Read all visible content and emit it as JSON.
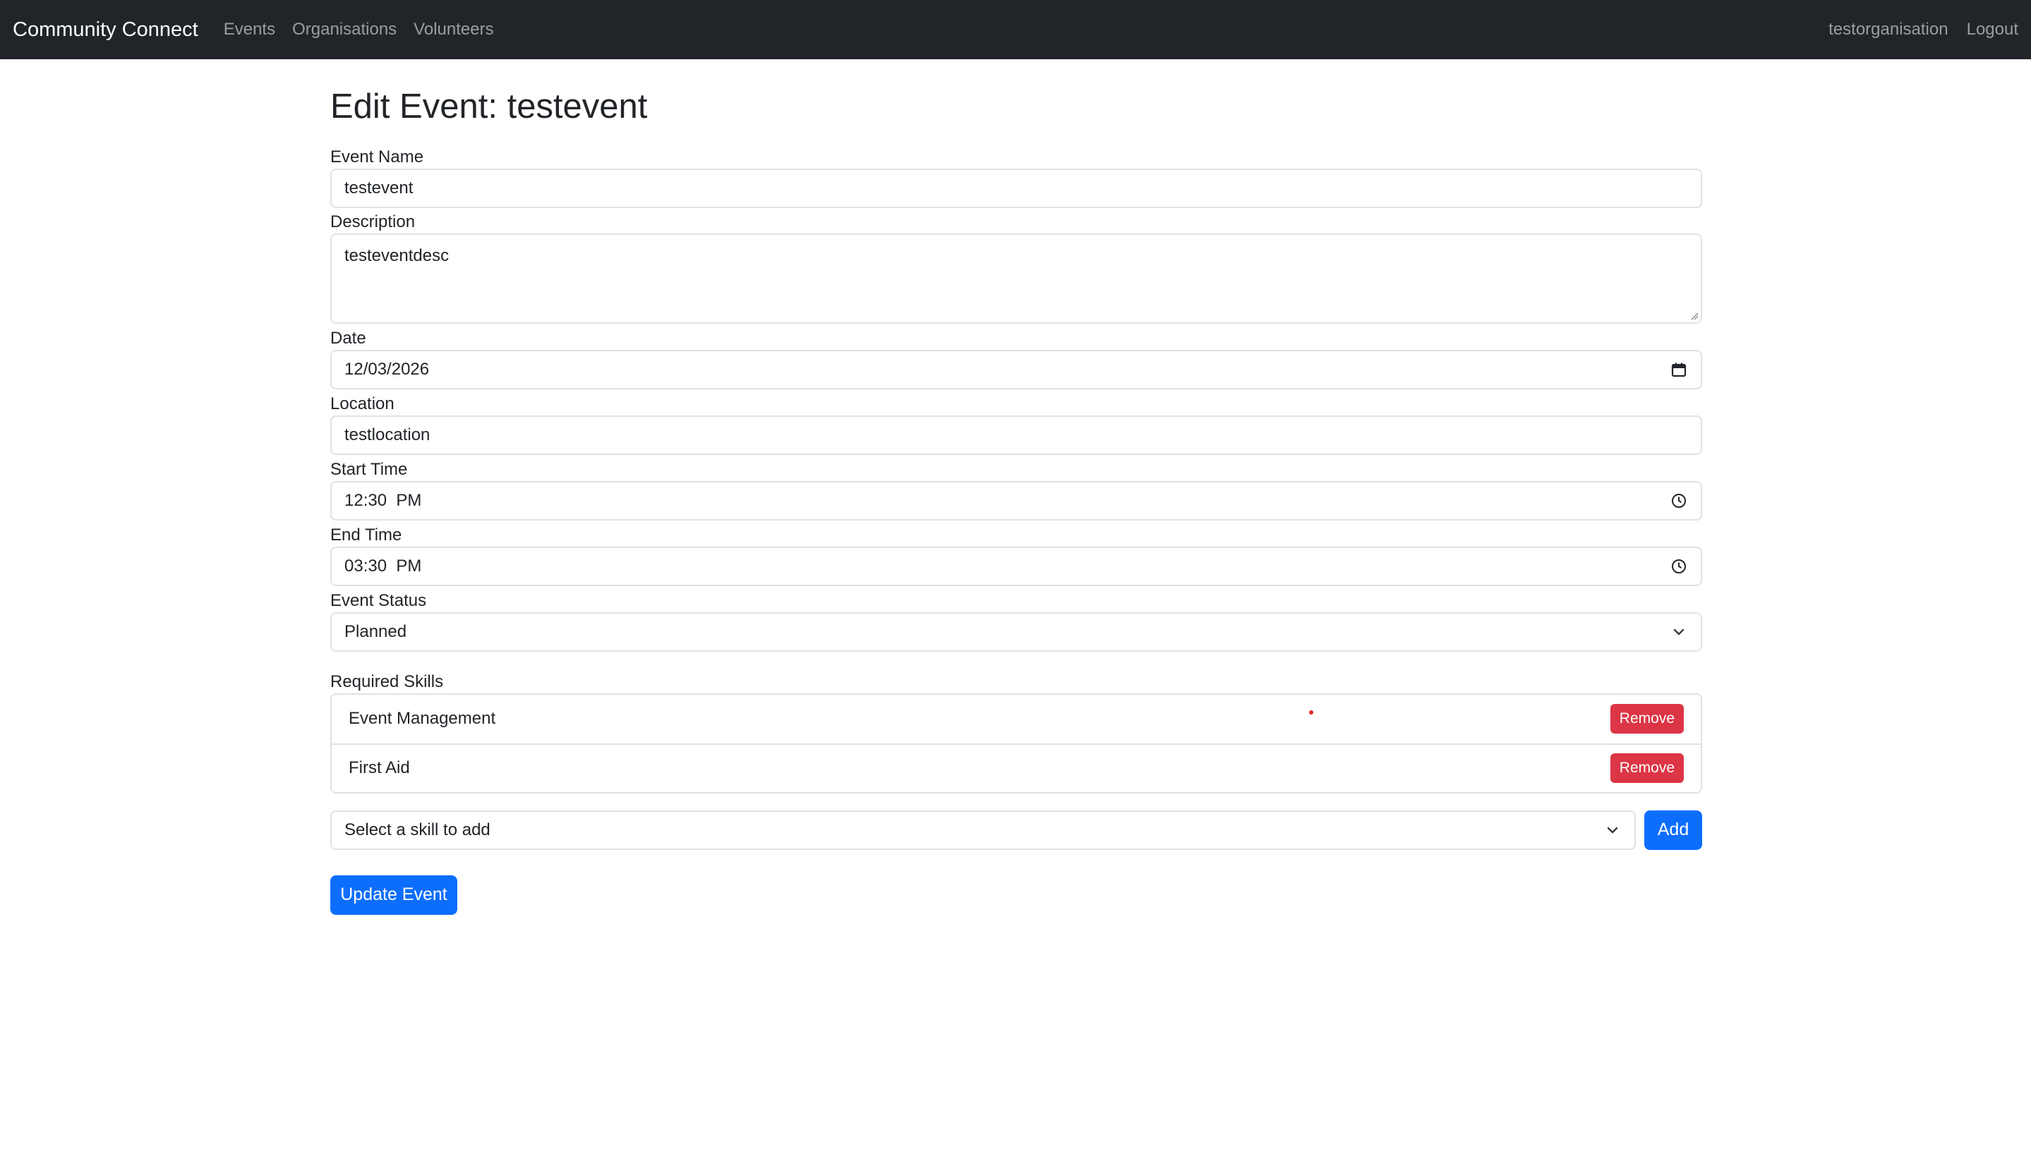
{
  "app": {
    "brand": "Community Connect",
    "nav_links": [
      "Events",
      "Organisations",
      "Volunteers"
    ],
    "user": "testorganisation",
    "logout": "Logout"
  },
  "page": {
    "title": "Edit Event: testevent"
  },
  "form": {
    "event_name": {
      "label": "Event Name",
      "value": "testevent"
    },
    "description": {
      "label": "Description",
      "value": "testeventdesc"
    },
    "date": {
      "label": "Date",
      "value": "12/03/2026",
      "icon": "calendar-icon"
    },
    "location": {
      "label": "Location",
      "value": "testlocation"
    },
    "start_time": {
      "label": "Start Time",
      "value": "12:30  PM",
      "icon": "clock-icon"
    },
    "end_time": {
      "label": "End Time",
      "value": "03:30  PM",
      "icon": "clock-icon"
    },
    "status": {
      "label": "Event Status",
      "value": "Planned",
      "icon": "chevron-down-icon"
    },
    "skills": {
      "label": "Required Skills",
      "items": [
        {
          "name": "Event Management",
          "action": "Remove"
        },
        {
          "name": "First Aid",
          "action": "Remove"
        }
      ],
      "add_select_placeholder": "Select a skill to add",
      "add_button": "Add"
    },
    "submit": "Update Event"
  },
  "colors": {
    "navbar": "#212529",
    "primary": "#0d6efd",
    "danger": "#dc3545",
    "border": "#dee2e6"
  }
}
